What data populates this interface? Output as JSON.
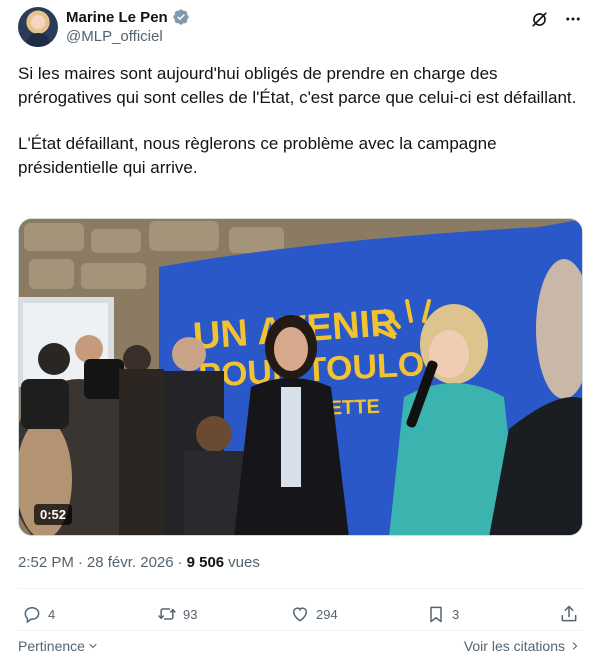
{
  "author": {
    "display_name": "Marine Le Pen",
    "handle": "@MLP_officiel",
    "verified_color": "#829aab"
  },
  "header_icons": [
    "grok-icon",
    "more-icon"
  ],
  "tweet": {
    "paragraph_1": "Si les maires sont aujourd'hui obligés de prendre en charge des prérogatives qui sont celles de l'État, c'est parce que celui-ci est défaillant.",
    "paragraph_2": "L'État défaillant, nous règlerons ce problème avec la campagne présidentielle qui arrive."
  },
  "media": {
    "banner_line_1": "UN AVENIR",
    "banner_line_2": "POUR TOULON",
    "banner_line_3": "LA VALETTE",
    "duration": "0:52"
  },
  "meta": {
    "time": "2:52 PM",
    "separator_1": "·",
    "date": "28 févr. 2026",
    "separator_2": "·",
    "views_count": "9 506",
    "views_label": "vues"
  },
  "actions": {
    "replies": "4",
    "reposts": "93",
    "likes": "294",
    "bookmarks": "3"
  },
  "footer": {
    "sort_label": "Pertinence",
    "quotes_label": "Voir les citations"
  },
  "colors": {
    "text_primary": "#0f1419",
    "text_secondary": "#536471",
    "banner_blue": "#2b58c8",
    "banner_yellow": "#f2c230"
  }
}
